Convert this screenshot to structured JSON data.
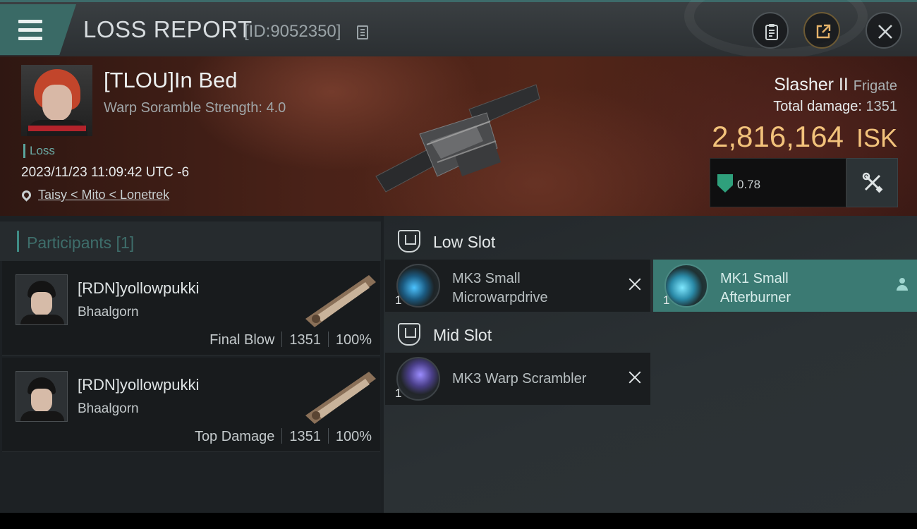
{
  "header": {
    "title": "LOSS REPORT",
    "report_id": "[ID:9052350]",
    "icons": [
      "menu-icon",
      "copy-icon",
      "clipboard-icon",
      "share-icon",
      "close-icon"
    ]
  },
  "victim": {
    "name": "[TLOU]In Bed",
    "scramble_strength": "Warp Soramble Strength: 4.0",
    "status": "Loss",
    "datetime": "2023/11/23 11:09:42 UTC -6",
    "location": "Taisy < Mito < Lonetrek",
    "ship_name": "Slasher II",
    "ship_class": "Frigate",
    "total_damage_label": "Total damage:",
    "total_damage": "1351",
    "isk_value": "2,816,164",
    "isk_unit": "ISK",
    "security": "0.78"
  },
  "participants": {
    "header": "Participants [1]",
    "items": [
      {
        "name": "[RDN]yollowpukki",
        "ship": "Bhaalgorn",
        "role": "Final Blow",
        "damage": "1351",
        "percent": "100%"
      },
      {
        "name": "[RDN]yollowpukki",
        "ship": "Bhaalgorn",
        "role": "Top Damage",
        "damage": "1351",
        "percent": "100%"
      }
    ]
  },
  "slots": {
    "low": {
      "label": "Low Slot",
      "modules": [
        {
          "line1": "MK3 Small",
          "line2": "Microwarpdrive",
          "qty": "1",
          "status": "destroyed"
        },
        {
          "line1": "MK1 Small",
          "line2": "Afterburner",
          "qty": "1",
          "status": "dropped"
        }
      ]
    },
    "mid": {
      "label": "Mid Slot",
      "modules": [
        {
          "line1": "MK3 Warp Scrambler",
          "qty": "1",
          "status": "destroyed"
        }
      ]
    }
  },
  "colors": {
    "accent": "#3b7a73",
    "isk": "#f2c27b",
    "security": "#2fa07c"
  }
}
